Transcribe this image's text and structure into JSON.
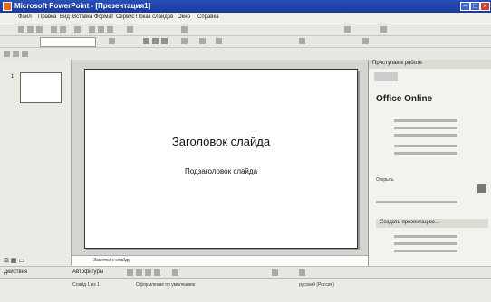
{
  "window": {
    "title": "Microsoft PowerPoint - [Презентация1]"
  },
  "menu": [
    "Файл",
    "Правка",
    "Вид",
    "Вставка",
    "Формат",
    "Сервис",
    "Показ слайдов",
    "Окно",
    "Справка"
  ],
  "slide": {
    "title": "Заголовок слайда",
    "subtitle": "Подзаголовок слайда"
  },
  "thumbnail_number": "1",
  "notes": {
    "placeholder": "Заметки к слайду"
  },
  "taskpane": {
    "header": "Приступая к работе",
    "office_online": "Office Online",
    "open_label": "Открыть",
    "section": "Создать презентацию..."
  },
  "drawbar": {
    "actions": "Действия",
    "autoshapes": "Автофигуры"
  },
  "statusbar": {
    "slide": "Слайд 1 из 1",
    "design": "Оформление по умолчанию",
    "lang": "русский (Россия)"
  }
}
